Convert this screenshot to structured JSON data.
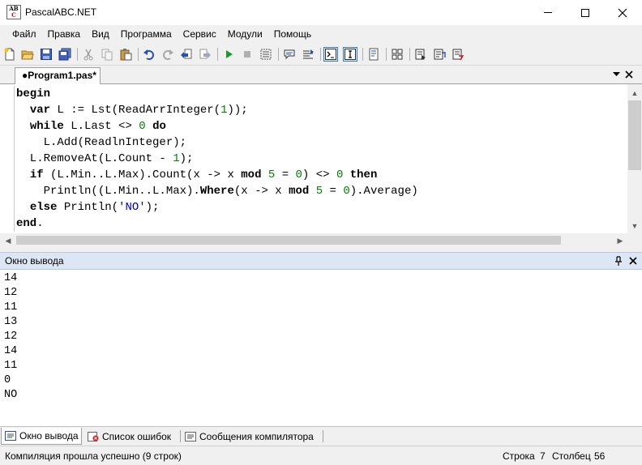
{
  "window": {
    "title": "PascalABC.NET",
    "icon_top": "AB",
    "icon_bottom": "C"
  },
  "menu": [
    "Файл",
    "Правка",
    "Вид",
    "Программа",
    "Сервис",
    "Модули",
    "Помощь"
  ],
  "toolbar_icons": [
    "new-file-icon",
    "open-folder-icon",
    "save-icon",
    "save-all-icon",
    "cut-icon",
    "copy-icon",
    "paste-icon",
    "undo-icon",
    "redo-icon",
    "back-icon",
    "forward-icon",
    "run-icon",
    "stop-icon",
    "compile-icon",
    "comment-icon",
    "uncomment-icon",
    "console-icon",
    "text-icon",
    "document-icon",
    "insert-icon",
    "debug-run-icon",
    "step-into-icon",
    "step-over-icon"
  ],
  "editor": {
    "tab_label": "●Program1.pas*",
    "lines": [
      "begin",
      "  var L := Lst(ReadArrInteger(1));",
      "  while L.Last <> 0 do",
      "    L.Add(ReadlnInteger);",
      "  L.RemoveAt(L.Count - 1);",
      "  if (L.Min..L.Max).Count(x -> x mod 5 = 0) <> 0 then",
      "    Println((L.Min..L.Max).Where(x -> x mod 5 = 0).Average)",
      "  else Println('NO');",
      "end."
    ]
  },
  "output": {
    "title": "Окно вывода",
    "lines": [
      "14",
      "12",
      "11",
      "13",
      "12",
      "14",
      "11",
      "0",
      "NO"
    ]
  },
  "bottom_tabs": [
    {
      "label": "Окно вывода",
      "active": true
    },
    {
      "label": "Список ошибок",
      "active": false
    },
    {
      "label": "Сообщения компилятора",
      "active": false
    }
  ],
  "status": {
    "message": "Компиляция прошла успешно (9 строк)",
    "row_label": "Строка",
    "row_value": "7",
    "col_label": "Столбец",
    "col_value": "56"
  },
  "colors": {
    "keyword": "#000000",
    "number": "#008000",
    "string": "#0000c0",
    "panel_header": "#dce6f4"
  }
}
